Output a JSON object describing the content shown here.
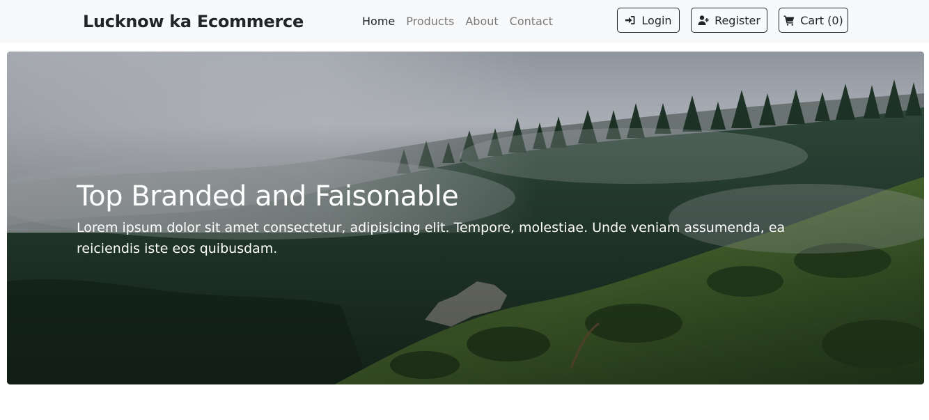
{
  "brand": "Lucknow ka Ecommerce",
  "nav": {
    "links": [
      "Home",
      "Products",
      "About",
      "Contact"
    ],
    "active": "Home"
  },
  "actions": {
    "login": {
      "label": "Login",
      "icon": "sign-in-icon"
    },
    "register": {
      "label": "Register",
      "icon": "user-plus-icon"
    },
    "cart": {
      "label": "Cart (0)",
      "icon": "shopping-cart-icon"
    }
  },
  "hero": {
    "title": "Top Branded and Faisonable",
    "text": "Lorem ipsum dolor sit amet consectetur, adipisicing elit. Tempore, molestiae. Unde veniam assumenda, ea reiciendis iste eos quibusdam."
  },
  "colors": {
    "navbar_bg": "#f8f9fa",
    "text_dark": "#212529",
    "nav_muted": "#7a7a7a"
  }
}
